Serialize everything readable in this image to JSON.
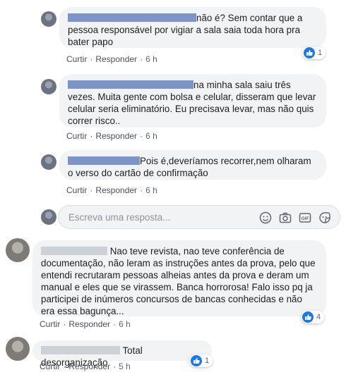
{
  "comments": [
    {
      "text": "não é? Sem contar que a pessoa responsável por vigiar a sala saia toda hora pra bater papo",
      "actions": {
        "like": "Curtir",
        "reply": "Responder",
        "time": "6 h"
      },
      "reactions": "1"
    },
    {
      "text": "na minha sala saiu três vezes. Muita gente com bolsa e celular, disseram que levar celular seria eliminatório. Eu precisava levar, mas não quis correr risco..",
      "actions": {
        "like": "Curtir",
        "reply": "Responder",
        "time": "6 h"
      }
    },
    {
      "text": "Pois é,deveríamos recorrer,nem olharam o verso do cartão de confirmação",
      "actions": {
        "like": "Curtir",
        "reply": "Responder",
        "time": "6 h"
      }
    },
    {
      "text": "Nao teve revista, nao teve conferência de documentação, não leram as instruções antes da prova, pelo que entendi recrutaram pessoas alheias antes da prova e deram um manual e eles que se virassem. Banca horrorosa! Falo isso pq ja participei de inúmeros concursos de bancas conhecidas e não era essa bagunça...",
      "actions": {
        "like": "Curtir",
        "reply": "Responder",
        "time": "6 h"
      },
      "reactions": "4"
    },
    {
      "text": "Total desorganização",
      "actions": {
        "like": "Curtir",
        "reply": "Responder",
        "time": "5 h"
      },
      "reactions": "1"
    }
  ],
  "reply_box": {
    "placeholder": "Escreva uma resposta..."
  },
  "icons": [
    "emoji-icon",
    "camera-icon",
    "gif-icon",
    "sticker-icon",
    "like-icon"
  ],
  "colors": {
    "like_blue": "#1877f2",
    "bubble_bg": "#f2f3f5",
    "redaction": "#7d94c8"
  }
}
